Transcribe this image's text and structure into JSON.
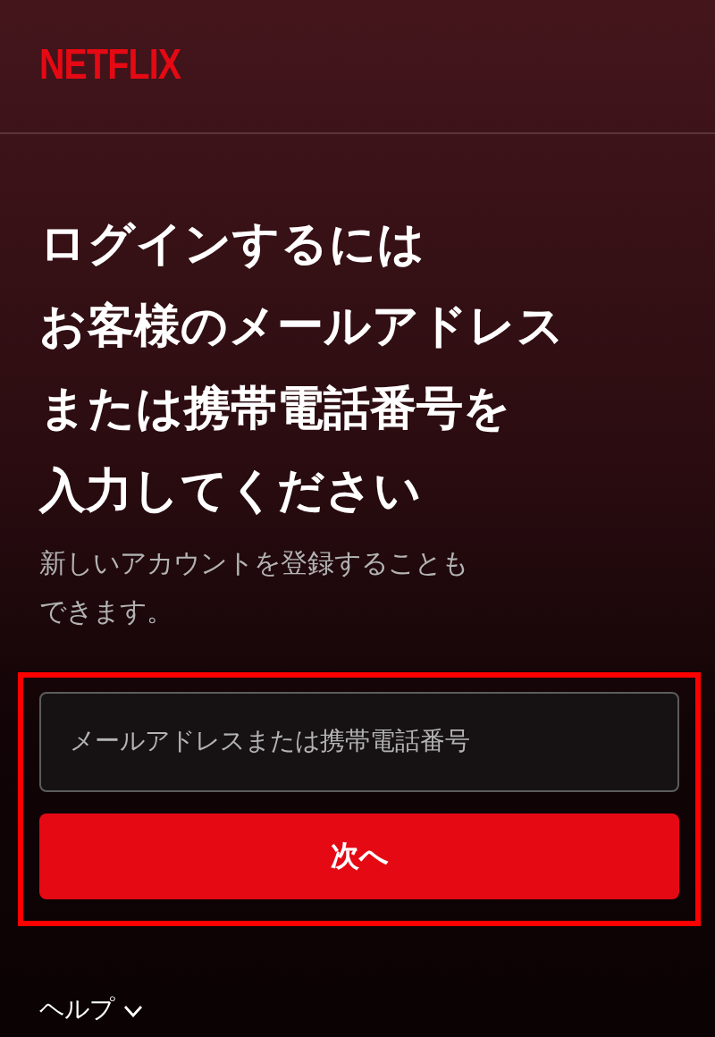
{
  "logo": "NETFLIX",
  "heading_lines": [
    "ログインするには",
    "お客様のメールアドレス",
    "または携帯電話番号を",
    "入力してください"
  ],
  "subtitle": "新しいアカウントを登録することもできます。",
  "email_field": {
    "placeholder": "メールアドレスまたは携帯電話番号"
  },
  "next_button": "次へ",
  "highlight": true,
  "help": {
    "label": "ヘルプ",
    "expanded": false
  }
}
